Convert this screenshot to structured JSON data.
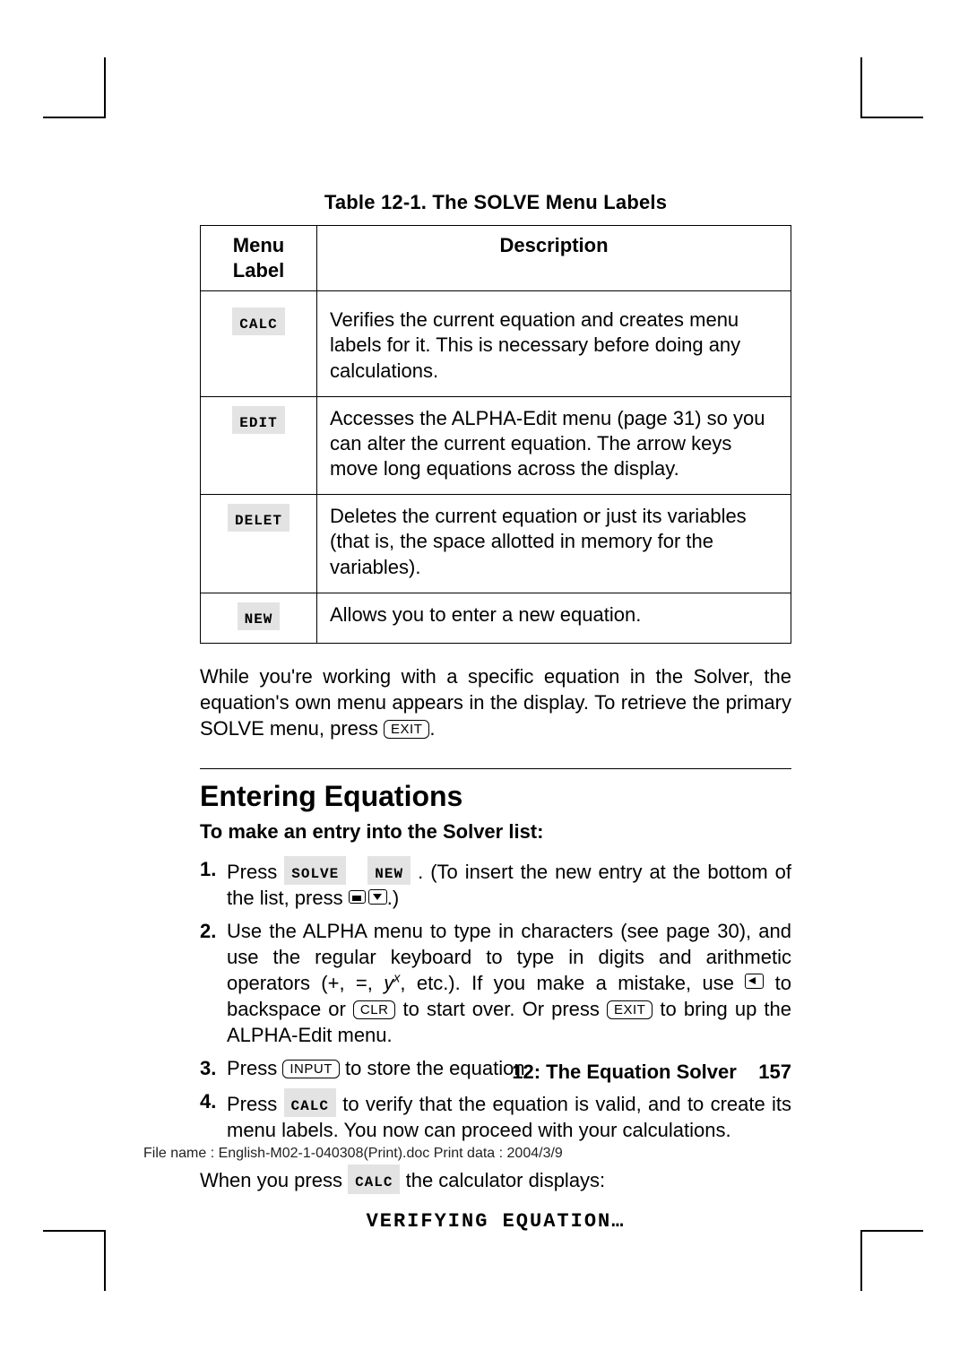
{
  "table": {
    "caption": "Table 12-1. The SOLVE Menu Labels",
    "headers": {
      "col1": "Menu Label",
      "col2": "Description"
    },
    "rows": [
      {
        "label": "CALC",
        "desc": "Verifies the current equation and creates menu labels for it. This is necessary before doing any calculations."
      },
      {
        "label": "EDIT",
        "desc": "Accesses the ALPHA-Edit menu (page 31) so you can alter the current equation. The arrow keys move long equations across the display."
      },
      {
        "label": "DELET",
        "desc": "Deletes the current equation or just its variables (that is, the space allotted in memory for the variables)."
      },
      {
        "label": "NEW",
        "desc": "Allows you to enter a new equation."
      }
    ]
  },
  "paragraph": {
    "pre": "While you're working with a specific equation in the Solver, the equation's own menu appears in the display. To retrieve the primary SOLVE menu, press ",
    "key": "EXIT",
    "post": "."
  },
  "section_title": "Entering Equations",
  "subheading": "To make an entry into the Solver list:",
  "steps": {
    "s1": {
      "a": "Press ",
      "key1": "SOLVE",
      "key2": "NEW",
      "b": ". (To insert the new entry at the bottom of the list, press ",
      "c": ".)"
    },
    "s2": {
      "a": "Use the ALPHA menu to type in characters (see page 30), and use the regular keyboard to type in digits and arithmetic operators (+, =, ",
      "yx_base": "y",
      "yx_sup": "x",
      "b": ", etc.). If you make a mistake, use ",
      "c": " to backspace or ",
      "clr": "CLR",
      "d": " to start over. Or press ",
      "exit": "EXIT",
      "e": " to bring up the ALPHA-Edit menu."
    },
    "s3": {
      "a": "Press ",
      "input": "INPUT",
      "b": " to store the equation."
    },
    "s4": {
      "a": "Press ",
      "calc": "CALC",
      "b": " to verify that the equation is valid, and to create its menu labels. You now can proceed with your calculations."
    }
  },
  "after": {
    "a": "When you press ",
    "calc": "CALC",
    "b": " the calculator displays:"
  },
  "lcd_message": "VERIFYING EQUATION…",
  "footer": {
    "chapter": "12: The Equation Solver",
    "page": "157"
  },
  "print_meta": "File name : English-M02-1-040308(Print).doc    Print data : 2004/3/9"
}
